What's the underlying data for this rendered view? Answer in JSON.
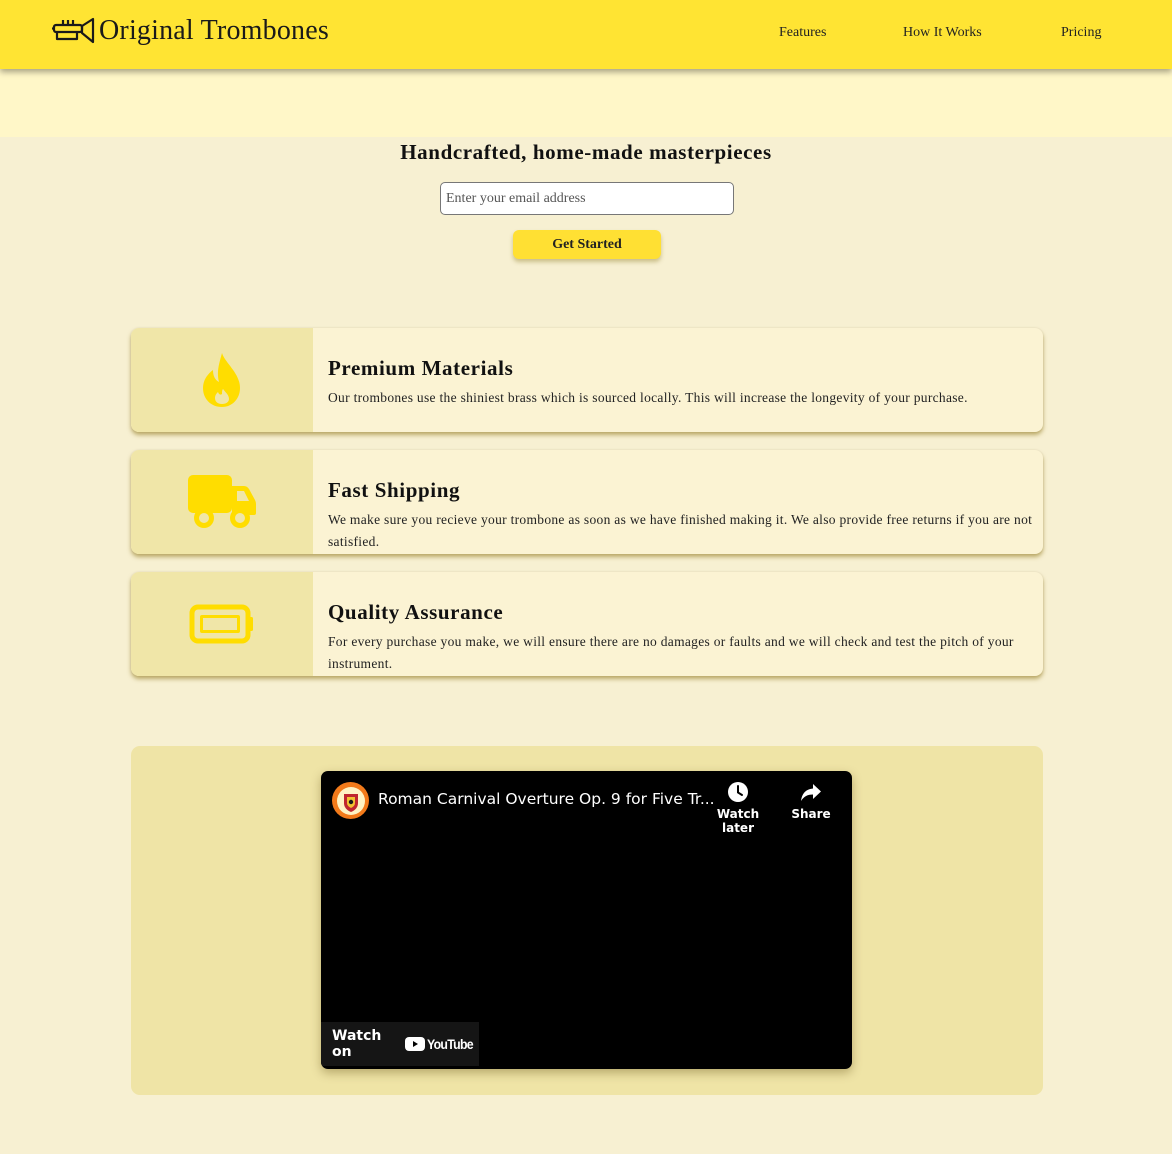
{
  "header": {
    "brand": "Original Trombones",
    "nav": [
      {
        "label": "Features"
      },
      {
        "label": "How It Works"
      },
      {
        "label": "Pricing"
      }
    ]
  },
  "hero": {
    "title": "Handcrafted, home-made masterpieces",
    "email_placeholder": "Enter your email address",
    "email_value": "",
    "cta_label": "Get Started"
  },
  "features": [
    {
      "icon": "fire-icon",
      "title": "Premium Materials",
      "description": "Our trombones use the shiniest brass which is sourced locally. This will increase the longevity of your purchase."
    },
    {
      "icon": "truck-icon",
      "title": "Fast Shipping",
      "description": "We make sure you recieve your trombone as soon as we have finished making it. We also provide free returns if you are not satisfied."
    },
    {
      "icon": "battery-icon",
      "title": "Quality Assurance",
      "description": "For every purchase you make, we will ensure there are no damages or faults and we will check and test the pitch of your instrument."
    }
  ],
  "video": {
    "title": "Roman Carnival Overture Op. 9 for Five Tr...",
    "watch_later_label": "Watch later",
    "share_label": "Share",
    "watch_on_label": "Watch on",
    "youtube_label": "YouTube"
  },
  "colors": {
    "header_bg": "#ffe433",
    "page_bg": "#f7f0d2",
    "accent": "#ffdd00",
    "card_icon_bg": "#f0e6a8"
  }
}
